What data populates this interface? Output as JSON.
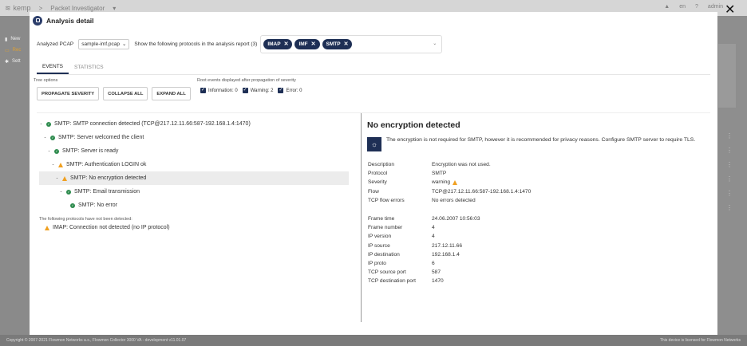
{
  "app": {
    "logo": "kemp",
    "breadcrumb": "Packet Investigator",
    "lang": "en",
    "user": "admin",
    "sidebar": [
      "New",
      "Rec",
      "Sett"
    ],
    "footer_left": "Copyright © 2007-2021 Flowmon Networks a.s., Flowmon Collector 3000 VA - development v11.01.07",
    "footer_right": "This device is licensed for Flowmon Networks"
  },
  "modal": {
    "title": "Analysis detail",
    "analyzed_label": "Analyzed PCAP",
    "pcap_value": "sample-imf.pcap",
    "protocols_label": "Show the following protocols in the analysis report (3)",
    "chips": [
      "IMAP",
      "IMF",
      "SMTP"
    ],
    "tabs": [
      "EVENTS",
      "STATISTICS"
    ],
    "tree_options_label": "Tree options",
    "buttons": {
      "propagate": "PROPAGATE SEVERITY",
      "collapse": "COLLAPSE ALL",
      "expand": "EXPAND ALL"
    },
    "root_events_label": "Root events displayed after propagation of severity",
    "checks": [
      "Information: 0",
      "Warning: 2",
      "Error: 0"
    ],
    "tree": [
      {
        "label": "SMTP: SMTP connection detected (TCP@217.12.11.66:587-192.168.1.4:1470)",
        "status": "ok",
        "depth": 0,
        "caret": "-"
      },
      {
        "label": "SMTP: Server welcomed the client",
        "status": "ok",
        "depth": 1,
        "caret": "-"
      },
      {
        "label": "SMTP: Server is ready",
        "status": "ok",
        "depth": 2,
        "caret": "-"
      },
      {
        "label": "SMTP: Authentication LOGIN ok",
        "status": "warn",
        "depth": 3,
        "caret": "-"
      },
      {
        "label": "SMTP: No encryption detected",
        "status": "warn",
        "depth": 4,
        "caret": "-",
        "selected": true
      },
      {
        "label": "SMTP: Email transmission",
        "status": "ok",
        "depth": 5,
        "caret": "-"
      },
      {
        "label": "SMTP: No error",
        "status": "ok",
        "depth": 6,
        "caret": ""
      }
    ],
    "not_detected_label": "The following protocols have not been detected:",
    "not_detected_item": "IMAP: Connection not detected (no IP protocol)",
    "detail": {
      "title": "No encryption detected",
      "info": "The encryption is not required for SMTP, however it is recommended for privacy reasons. Configure SMTP server to require TLS.",
      "fields1": [
        {
          "k": "Description",
          "v": "Encryption was not used."
        },
        {
          "k": "Protocol",
          "v": "SMTP"
        },
        {
          "k": "Severity",
          "v": "warning"
        },
        {
          "k": "Flow",
          "v": "TCP@217.12.11.66:587-192.168.1.4:1470"
        },
        {
          "k": "TCP flow errors",
          "v": "No errors detected"
        }
      ],
      "fields2": [
        {
          "k": "Frame time",
          "v": "24.06.2007 10:56:03"
        },
        {
          "k": "Frame number",
          "v": "4"
        },
        {
          "k": "IP version",
          "v": "4"
        },
        {
          "k": "IP source",
          "v": "217.12.11.66"
        },
        {
          "k": "IP destination",
          "v": "192.168.1.4"
        },
        {
          "k": "IP proto",
          "v": "6"
        },
        {
          "k": "TCP source port",
          "v": "587"
        },
        {
          "k": "TCP destination port",
          "v": "1470"
        }
      ]
    }
  }
}
